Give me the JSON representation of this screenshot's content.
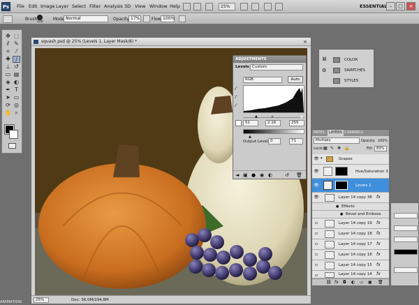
{
  "menubar": {
    "logo": "Ps",
    "items": [
      "File",
      "Edit",
      "Image",
      "Layer",
      "Select",
      "Filter",
      "Analysis",
      "3D",
      "View",
      "Window",
      "Help"
    ],
    "zoom": "25%",
    "workspace": "ESSENTIALS"
  },
  "options": {
    "brush_label": "Brush:",
    "brush_size": "100",
    "mode_label": "Mode:",
    "mode_value": "Normal",
    "opacity_label": "Opacity:",
    "opacity_value": "17%",
    "flow_label": "Flow:",
    "flow_value": "100%"
  },
  "document": {
    "title": "squash.psd @ 25% (Levels 1, Layer Mask/8) *",
    "zoom": "25%",
    "doc_size": "Doc: 36.0M/294.8M",
    "animation_tab": "ANIMATION"
  },
  "adjustments": {
    "tab": "ADJUSTMENTS",
    "levels_label": "Levels",
    "preset": "Custom",
    "channel": "RGB",
    "auto_button": "Auto",
    "input_black": "51",
    "input_gamma": "2.16",
    "input_white": "255",
    "output_label": "Output Levels:",
    "output_black": "0",
    "output_white": "71"
  },
  "mini_panel": {
    "items": [
      "COLOR",
      "SWATCHES",
      "STYLES"
    ]
  },
  "layers": {
    "tabs": [
      "PATHS",
      "LAYERS",
      "CHANNELS"
    ],
    "blend_mode": "Multiply",
    "opacity_label": "Opacity:",
    "opacity_value": "100%",
    "lock_label": "Lock:",
    "fill_label": "Fill:",
    "fill_value": "83%",
    "rows": [
      {
        "name": "Grapes",
        "type": "group"
      },
      {
        "name": "Hue/Saturation 3",
        "type": "adj"
      },
      {
        "name": "Levels 1",
        "type": "adj",
        "selected": true
      },
      {
        "name": "Layer 14 copy 38",
        "type": "layer",
        "fx": true
      },
      {
        "name": "Effects",
        "type": "effect"
      },
      {
        "name": "Bevel and Emboss",
        "type": "effect"
      },
      {
        "name": "Layer 14 copy 19",
        "type": "layer",
        "fx": true
      },
      {
        "name": "Layer 14 copy 18",
        "type": "layer",
        "fx": true
      },
      {
        "name": "Layer 14 copy 17",
        "type": "layer",
        "fx": true
      },
      {
        "name": "Layer 14 copy 16",
        "type": "layer",
        "fx": true
      },
      {
        "name": "Layer 14 copy 15",
        "type": "layer",
        "fx": true
      },
      {
        "name": "Layer 14 copy 14",
        "type": "layer",
        "fx": true
      }
    ]
  },
  "colors": {
    "selection": "#3f8fdc",
    "canvas_bg": "#4a3a1d"
  }
}
